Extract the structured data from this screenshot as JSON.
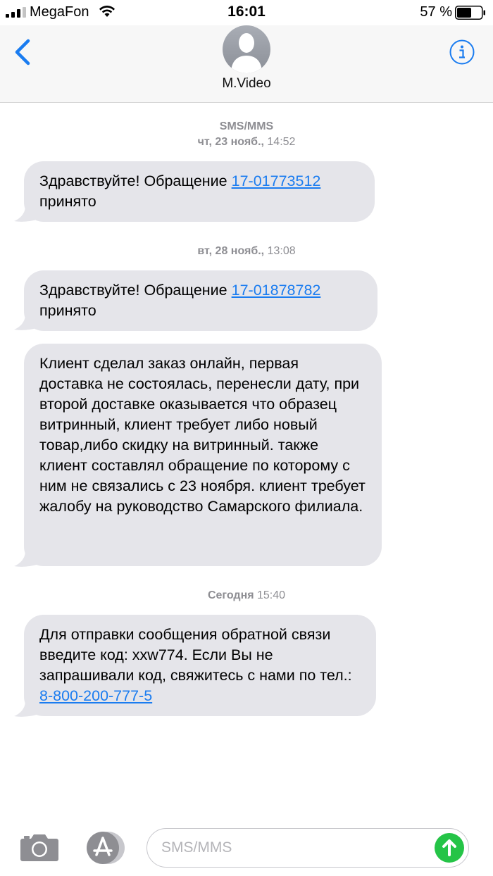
{
  "status_bar": {
    "carrier": "MegaFon",
    "time": "16:01",
    "battery": "57 %"
  },
  "header": {
    "back_icon": "chevron-left-icon",
    "contact_name": "M.Video",
    "info_icon": "info-icon"
  },
  "thread": {
    "service": "SMS/MMS",
    "groups": [
      {
        "day": "чт, 23 нояб.,",
        "time": " 14:52",
        "messages": [
          {
            "text_before": "Здравствуйте! Обращение ",
            "link": "17-01773512",
            "text_after": "\nпринято"
          }
        ]
      },
      {
        "day": "вт, 28 нояб.,",
        "time": " 13:08",
        "messages": [
          {
            "text_before": "Здравствуйте! Обращение ",
            "link": "17-01878782",
            "text_after": "\nпринято"
          },
          {
            "text": "Клиент сделал заказ онлайн, первая доставка не состоялась, перенесли дату, при второй доставке оказывается что образец витринный, клиент требует либо новый товар,либо скидку на витринный. также клиент составлял обращение по которому с ним не связались с 23 ноября. клиент требует жалобу на руководство Самарского филиала."
          }
        ]
      },
      {
        "day": "Сегодня",
        "time": " 15:40",
        "messages": [
          {
            "text_before": "Для отправки сообщения обратной связи введите код: xxw774. Если Вы не запрашивали код, свяжитесь с нами по тел.: ",
            "link": "8-800-200-777-5",
            "text_after": ""
          }
        ]
      }
    ]
  },
  "composer": {
    "placeholder": "SMS/MMS",
    "value": ""
  },
  "colors": {
    "accent": "#1a7cf0",
    "bubble": "#e5e5ea",
    "send": "#25c447"
  }
}
